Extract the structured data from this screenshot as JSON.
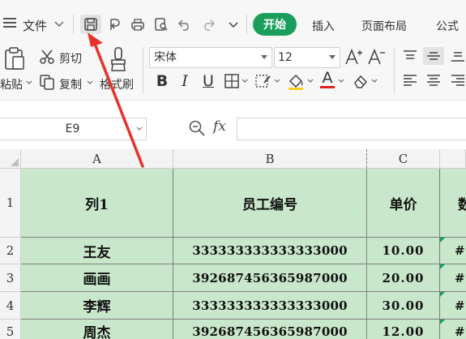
{
  "menu": {
    "file_label": "文件",
    "icons": [
      "hamburger-menu-icon",
      "chevron-down-icon"
    ]
  },
  "quick_access": [
    "save-icon",
    "export-icon",
    "print-icon",
    "print-preview-icon",
    "undo-icon",
    "redo-icon",
    "more-dropdown-icon"
  ],
  "tabs": {
    "home": "开始",
    "insert": "插入",
    "page_layout": "页面布局",
    "formulas": "公式"
  },
  "ribbon": {
    "paste_label": "粘贴",
    "cut_label": "剪切",
    "copy_label": "复制",
    "format_painter_label": "格式刷",
    "font_name": "宋体",
    "font_size": "12",
    "bold": "B",
    "italic": "I",
    "underline": "U",
    "font_color_letter": "A"
  },
  "formula_bar": {
    "name_box": "E9",
    "fx_label": "fx",
    "value": ""
  },
  "sheet": {
    "column_headers": [
      "A",
      "B",
      "C"
    ],
    "row_headers": [
      "1",
      "2",
      "3",
      "4",
      "5"
    ],
    "header_row": [
      "列1",
      "员工编号",
      "单价",
      "数"
    ],
    "rows": [
      {
        "name": "王友",
        "id": "333333333333333000",
        "price": "10.00",
        "d": "#N"
      },
      {
        "name": "画画",
        "id": "392687456365987000",
        "price": "20.00",
        "d": "#N"
      },
      {
        "name": "李辉",
        "id": "333333333333333000",
        "price": "30.00",
        "d": "#N"
      },
      {
        "name": "周杰",
        "id": "392687456365987000",
        "price": "12.00",
        "d": "#N"
      }
    ]
  },
  "colors": {
    "accent": "#1a9e5c",
    "cell_fill": "#c9e7cb",
    "annotation_arrow": "#e8322b"
  }
}
